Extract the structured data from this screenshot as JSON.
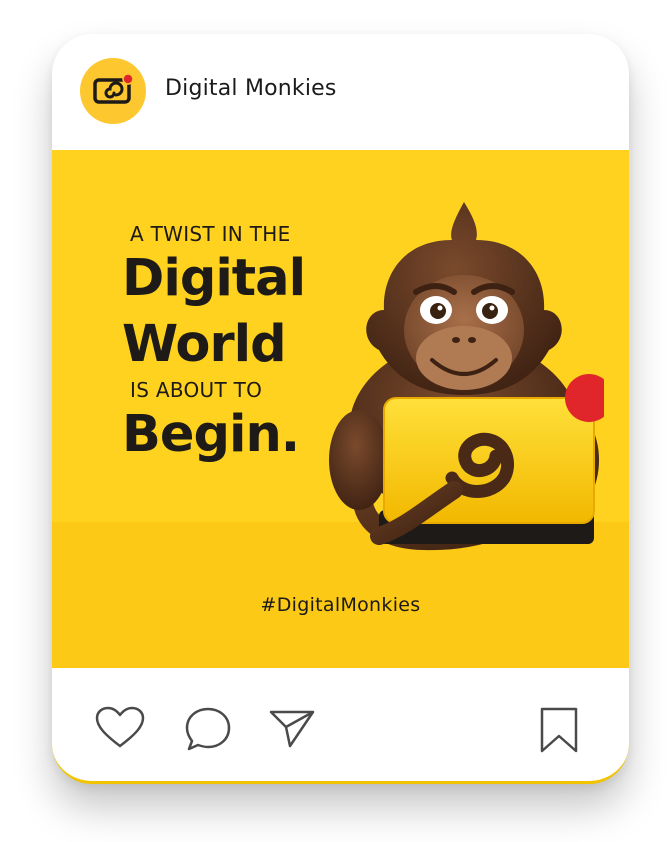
{
  "post": {
    "account_name": "Digital Monkies",
    "headline": {
      "line1": "A TWIST IN THE",
      "line2": "Digital",
      "line3": "World",
      "line4": "IS ABOUT TO",
      "line5": "Begin."
    },
    "hashtag": "#DigitalMonkies"
  },
  "icons": {
    "avatar": "digital-monkies-logo-icon",
    "like": "heart-icon",
    "comment": "comment-bubble-icon",
    "share": "paper-plane-icon",
    "save": "bookmark-icon"
  },
  "colors": {
    "brand_yellow": "#ffd21f",
    "accent_red": "#e0262a",
    "monkey_brown": "#5a3520",
    "text_dark": "#1d1a17"
  }
}
